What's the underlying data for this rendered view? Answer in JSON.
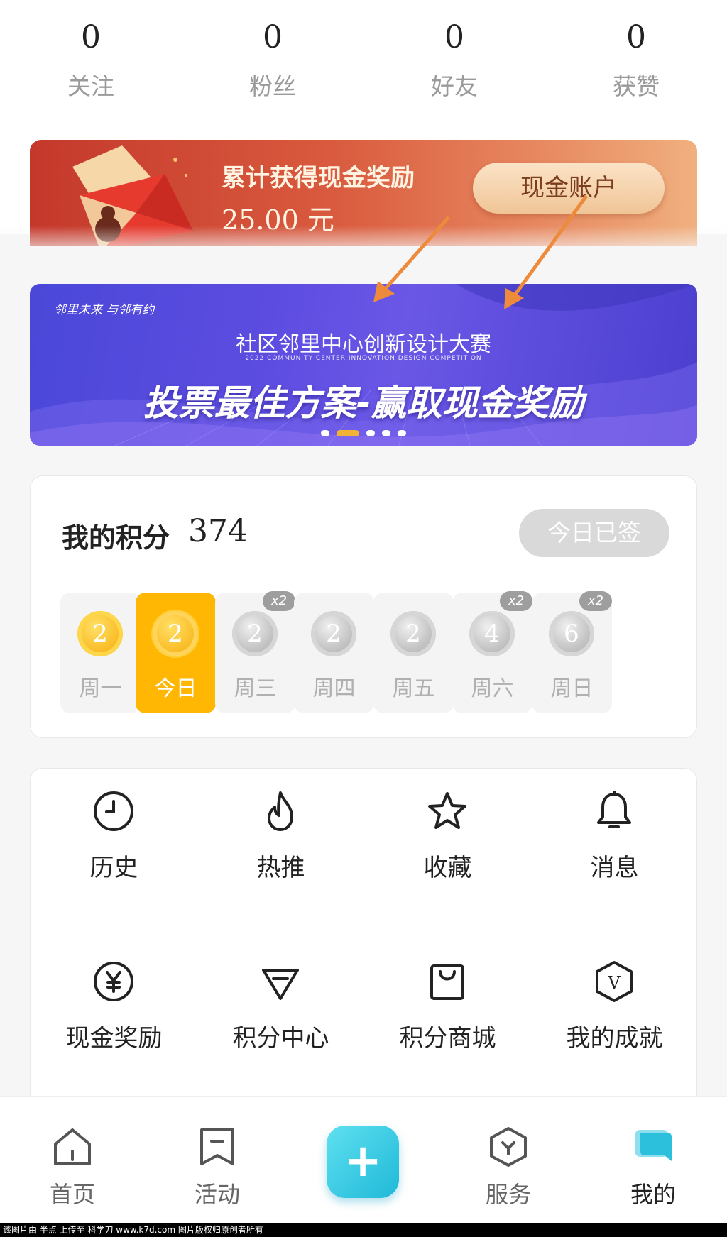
{
  "stats": [
    {
      "value": "0",
      "label": "关注"
    },
    {
      "value": "0",
      "label": "粉丝"
    },
    {
      "value": "0",
      "label": "好友"
    },
    {
      "value": "0",
      "label": "获赞"
    }
  ],
  "reward": {
    "title": "累计获得现金奖励",
    "amount": "25.00 元",
    "button": "现金账户"
  },
  "banner": {
    "slogan": "邻里未来 与邻有约",
    "subtitle": "社区邻里中心创新设计大赛",
    "english": "2022 COMMUNITY CENTER INNOVATION DESIGN COMPETITION",
    "headline": "投票最佳方案-赢取现金奖励",
    "slide_count": 5,
    "active_slide": 2
  },
  "points": {
    "title": "我的积分",
    "value": "374",
    "signed_button": "今日已签",
    "days": [
      {
        "label": "周一",
        "points": "2",
        "state": "gold",
        "badge": ""
      },
      {
        "label": "今日",
        "points": "2",
        "state": "today",
        "badge": ""
      },
      {
        "label": "周三",
        "points": "2",
        "state": "silver",
        "badge": "x2"
      },
      {
        "label": "周四",
        "points": "2",
        "state": "silver",
        "badge": ""
      },
      {
        "label": "周五",
        "points": "2",
        "state": "silver",
        "badge": ""
      },
      {
        "label": "周六",
        "points": "4",
        "state": "silver",
        "badge": "x2"
      },
      {
        "label": "周日",
        "points": "6",
        "state": "silver",
        "badge": "x2"
      }
    ]
  },
  "functions": [
    {
      "label": "历史",
      "icon": "clock-icon"
    },
    {
      "label": "热推",
      "icon": "flame-icon"
    },
    {
      "label": "收藏",
      "icon": "star-icon"
    },
    {
      "label": "消息",
      "icon": "bell-icon"
    },
    {
      "label": "现金奖励",
      "icon": "yen-icon"
    },
    {
      "label": "积分中心",
      "icon": "diamond-icon"
    },
    {
      "label": "积分商城",
      "icon": "shopping-bag-icon"
    },
    {
      "label": "我的成就",
      "icon": "v-badge-icon"
    }
  ],
  "tabbar": {
    "tabs": [
      {
        "label": "首页",
        "icon": "home-icon"
      },
      {
        "label": "活动",
        "icon": "activity-icon"
      },
      {
        "label": "",
        "icon": "plus-icon"
      },
      {
        "label": "服务",
        "icon": "service-icon"
      },
      {
        "label": "我的",
        "icon": "chat-bubble-icon"
      }
    ],
    "active": "我的"
  },
  "watermark": "该图片由 半点 上传至 科学刀 www.k7d.com 图片版权归原创者所有",
  "colors": {
    "accent_gold": "#ffb703",
    "plus_button": "#1fb9d8",
    "reward_red": "#c4382b",
    "banner_purple": "#5c4ce0"
  }
}
